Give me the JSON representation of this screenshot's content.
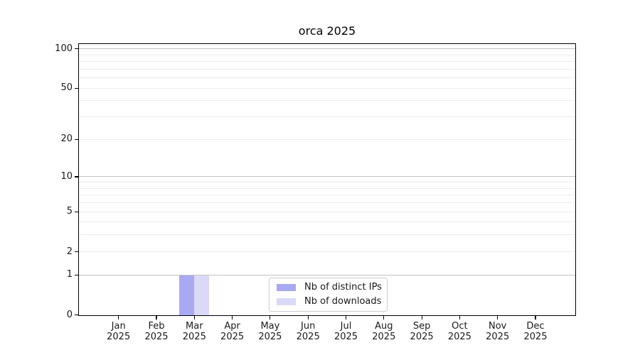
{
  "chart_data": {
    "type": "bar",
    "title": "orca 2025",
    "year": "2025",
    "categories": [
      "Jan",
      "Feb",
      "Mar",
      "Apr",
      "May",
      "Jun",
      "Jul",
      "Aug",
      "Sep",
      "Oct",
      "Nov",
      "Dec"
    ],
    "y_scale": "log1p",
    "yticks": [
      0,
      1,
      2,
      5,
      10,
      20,
      50,
      100
    ],
    "decade_ticks": [
      1,
      10,
      100
    ],
    "minor_gridlines": [
      3,
      4,
      6,
      7,
      8,
      9,
      30,
      40,
      60,
      70,
      80,
      90
    ],
    "ylim": [
      0,
      112
    ],
    "grid": true,
    "legend_position": "inside-bottom-center",
    "series": [
      {
        "name": "Nb of distinct IPs",
        "color": "#a9a9f3",
        "values": [
          0,
          0,
          1,
          0,
          0,
          0,
          0,
          0,
          0,
          0,
          0,
          0
        ]
      },
      {
        "name": "Nb of downloads",
        "color": "#dadaf8",
        "values": [
          0,
          0,
          1,
          0,
          0,
          0,
          0,
          0,
          0,
          0,
          0,
          0
        ]
      }
    ]
  }
}
